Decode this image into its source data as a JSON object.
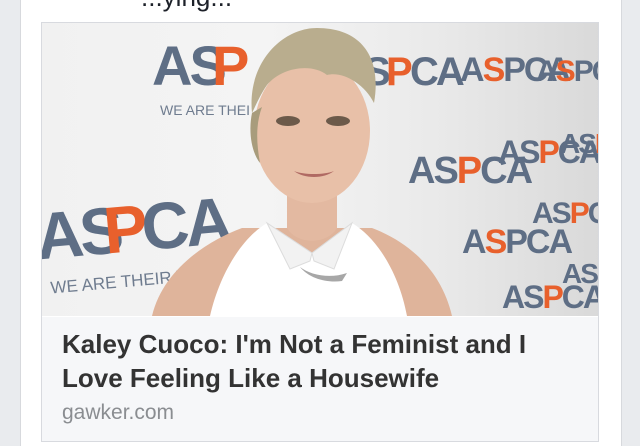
{
  "post": {
    "text_fragment": "...ying..."
  },
  "link_card": {
    "image": {
      "backdrop_logo": "ASPCA",
      "backdrop_tagline": "WE ARE THEIR VOICE",
      "backdrop_colors": {
        "blue": "#5e6e85",
        "orange": "#e8602c",
        "backdrop": "#efefef"
      }
    },
    "headline": "Kaley Cuoco: I'm Not a Feminist and I Love Feeling Like a Housewife",
    "domain": "gawker.com"
  }
}
